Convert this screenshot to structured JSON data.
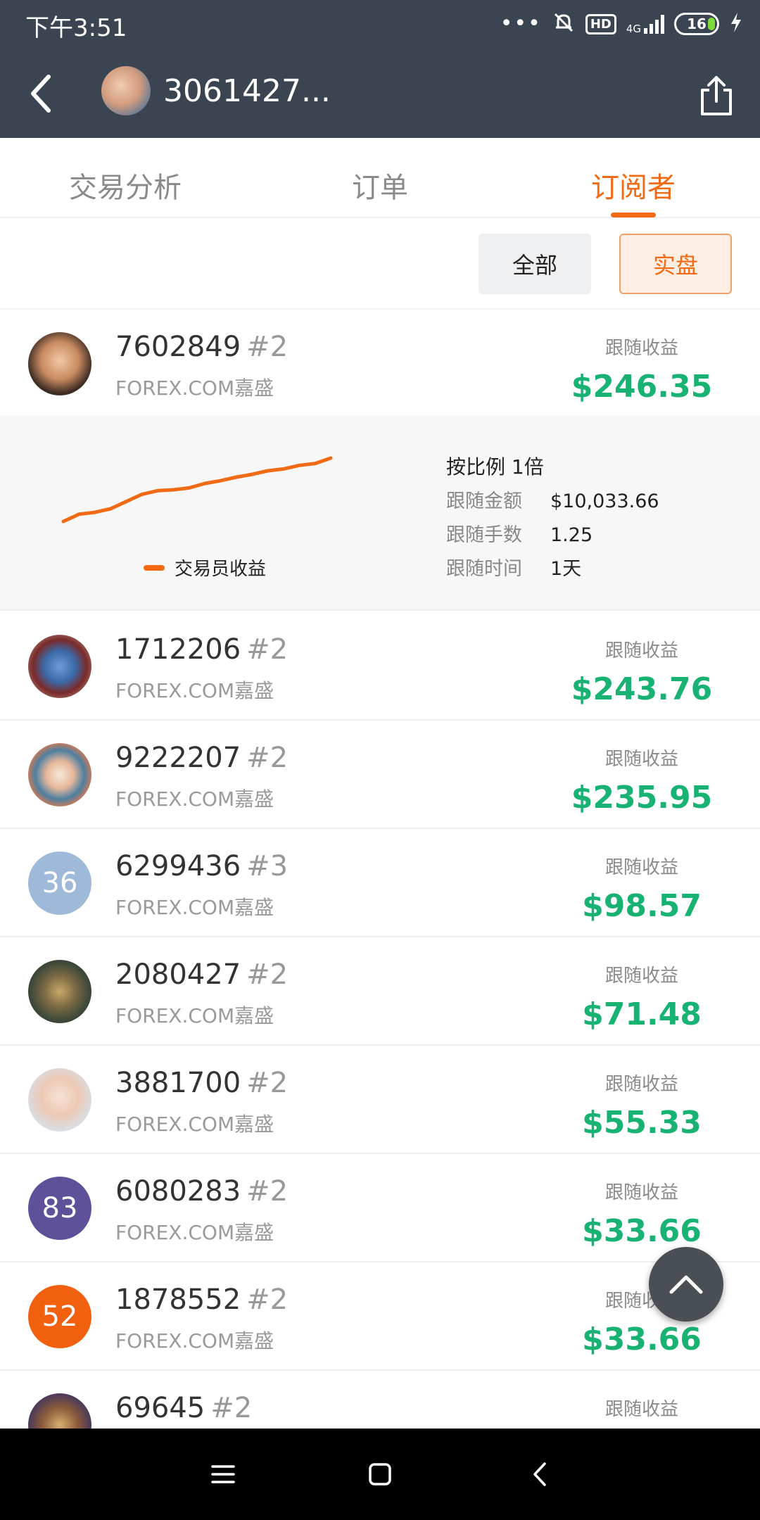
{
  "status_bar": {
    "time": "下午3:51",
    "network": "4G",
    "hd": "HD",
    "battery": "16"
  },
  "header": {
    "title": "3061427...",
    "back_icon": "chevron-left-icon",
    "share_icon": "share-icon"
  },
  "tabs": [
    {
      "label": "交易分析",
      "active": false
    },
    {
      "label": "订单",
      "active": false
    },
    {
      "label": "订阅者",
      "active": true
    }
  ],
  "filters": {
    "all": "全部",
    "real": "实盘"
  },
  "colors": {
    "accent": "#f26b14",
    "profit": "#18b273",
    "header_bg": "#3b4451"
  },
  "subscribers": [
    {
      "id": "7602849",
      "rank": "#2",
      "broker": "FOREX.COM嘉盛",
      "profit_label": "跟随收益",
      "profit": "$246.35",
      "avatar_text": ""
    },
    {
      "id": "1712206",
      "rank": "#2",
      "broker": "FOREX.COM嘉盛",
      "profit_label": "跟随收益",
      "profit": "$243.76",
      "avatar_text": ""
    },
    {
      "id": "9222207",
      "rank": "#2",
      "broker": "FOREX.COM嘉盛",
      "profit_label": "跟随收益",
      "profit": "$235.95",
      "avatar_text": ""
    },
    {
      "id": "6299436",
      "rank": "#3",
      "broker": "FOREX.COM嘉盛",
      "profit_label": "跟随收益",
      "profit": "$98.57",
      "avatar_text": "36"
    },
    {
      "id": "2080427",
      "rank": "#2",
      "broker": "FOREX.COM嘉盛",
      "profit_label": "跟随收益",
      "profit": "$71.48",
      "avatar_text": ""
    },
    {
      "id": "3881700",
      "rank": "#2",
      "broker": "FOREX.COM嘉盛",
      "profit_label": "跟随收益",
      "profit": "$55.33",
      "avatar_text": ""
    },
    {
      "id": "6080283",
      "rank": "#2",
      "broker": "FOREX.COM嘉盛",
      "profit_label": "跟随收益",
      "profit": "$33.66",
      "avatar_text": "83"
    },
    {
      "id": "1878552",
      "rank": "#2",
      "broker": "FOREX.COM嘉盛",
      "profit_label": "跟随收益",
      "profit": "$33.66",
      "avatar_text": "52"
    },
    {
      "id": "69645",
      "rank": "#2",
      "broker": "",
      "profit_label": "跟随收益",
      "profit": "",
      "avatar_text": ""
    }
  ],
  "detail": {
    "ratio": "按比例 1倍",
    "legend": "交易员收益",
    "rows": [
      {
        "key": "跟随金额",
        "value": "$10,033.66"
      },
      {
        "key": "跟随手数",
        "value": "1.25"
      },
      {
        "key": "跟随时间",
        "value": "1天"
      }
    ],
    "series": [
      0,
      4,
      5,
      7,
      11,
      15,
      17,
      17.5,
      18.5,
      21,
      22.5,
      24.5,
      26,
      28,
      29,
      31,
      32,
      35
    ]
  },
  "fab_icon": "chevron-up-icon",
  "nav": {
    "menu_icon": "menu-icon",
    "home_icon": "home-icon",
    "back_icon": "back-icon"
  }
}
